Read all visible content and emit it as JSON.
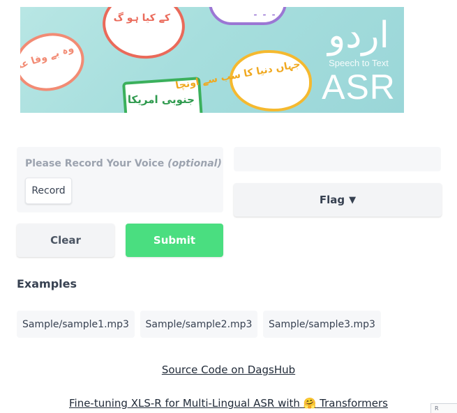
{
  "banner": {
    "bubble_texts": [
      "وہ بے وفا عدن ہو",
      "کے کیا ہو گ",
      "جہاں دنیا کا سب سے اونچا",
      "جنوبی امریکا",
      "۔ ۔ ۔"
    ],
    "logo_urdu": "اردو",
    "logo_subtitle": "Speech to Text",
    "logo_title": "ASR"
  },
  "input": {
    "record_label": "Please Record Your Voice",
    "record_label_optional": "(optional)",
    "record_button": "Record"
  },
  "actions": {
    "clear": "Clear",
    "submit": "Submit",
    "flag": "Flag",
    "flag_arrow": "▼"
  },
  "output": {
    "value": ""
  },
  "examples": {
    "title": "Examples",
    "items": [
      "Sample/sample1.mp3",
      "Sample/sample2.mp3",
      "Sample/sample3.mp3"
    ]
  },
  "footer": {
    "source_link": "Source Code on DagsHub",
    "paper_link_prefix": "Fine-tuning XLS-R for Multi-Lingual ASR with",
    "paper_link_emoji": "🤗",
    "paper_link_suffix": "Transformers",
    "corner_badge": "R"
  },
  "colors": {
    "submit_bg": "#4ade80",
    "panel_bg": "#f6f7f9",
    "banner_bg": "#a6dedd"
  }
}
